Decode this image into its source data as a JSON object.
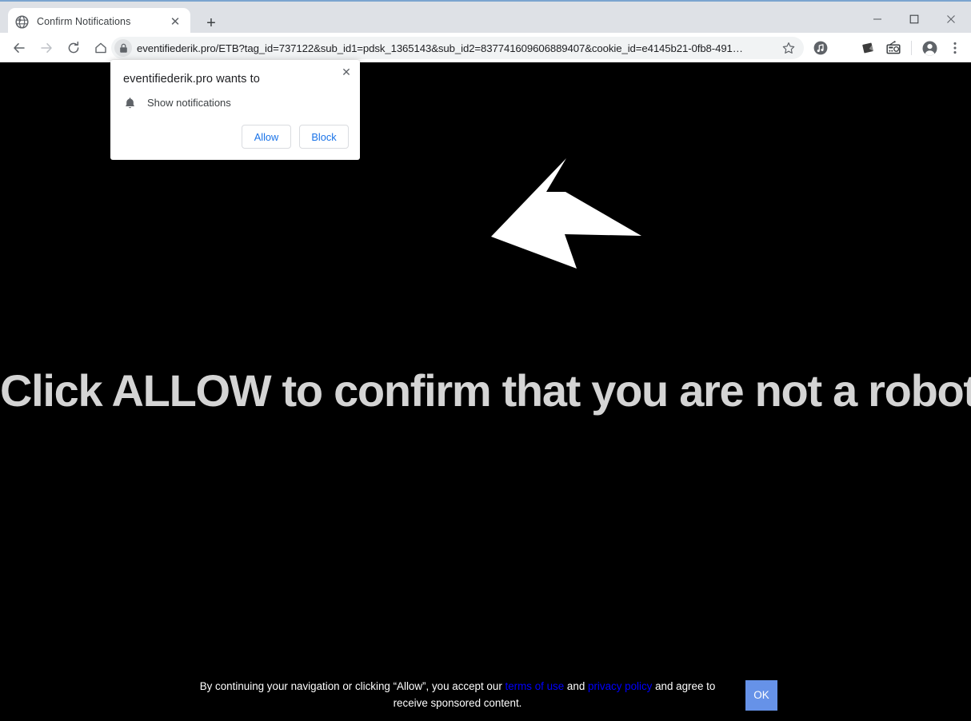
{
  "browser": {
    "tab": {
      "title": "Confirm Notifications",
      "favicon": "globe-icon",
      "close_label": "✕"
    },
    "new_tab_label": "+",
    "window_controls": {
      "minimize": "minimize-icon",
      "maximize": "maximize-icon",
      "close": "close-icon"
    },
    "nav": {
      "back": "back-arrow-icon",
      "forward": "forward-arrow-icon",
      "reload": "reload-icon",
      "home": "home-icon"
    },
    "omnibox": {
      "url": "eventifiederik.pro/ETB?tag_id=737122&sub_id1=pdsk_1365143&sub_id2=837741609606889407&cookie_id=e4145b21-0fb8-491…",
      "site_info": "lock-icon",
      "bookmark": "star-icon"
    },
    "toolbar_icons": [
      "music-note-extension-icon",
      "dark-square-extension-icon",
      "radio-extension-icon"
    ],
    "profile_icon": "account-avatar-icon",
    "menu_icon": "three-dot-menu-icon"
  },
  "permission_dialog": {
    "title": "eventifiederik.pro wants to",
    "permission_icon": "bell-icon",
    "permission_label": "Show notifications",
    "allow_label": "Allow",
    "block_label": "Block",
    "close_label": "✕",
    "accent_color": "#1a73e8"
  },
  "page": {
    "background_color": "#000000",
    "arrow": "left-pointing-arrow-graphic",
    "heading": "Click ALLOW to confirm that you are not a robot!",
    "heading_color": "#d4d4d4",
    "consent": {
      "text_before_link1": "By continuing your navigation or clicking “Allow”, you accept our ",
      "link1": "terms of use",
      "text_between_links": " and ",
      "link2": "privacy policy",
      "text_after_link2": " and agree to receive sponsored content.",
      "link_color": "#0000ff",
      "ok_label": "OK",
      "ok_color": "#6692e8"
    }
  }
}
